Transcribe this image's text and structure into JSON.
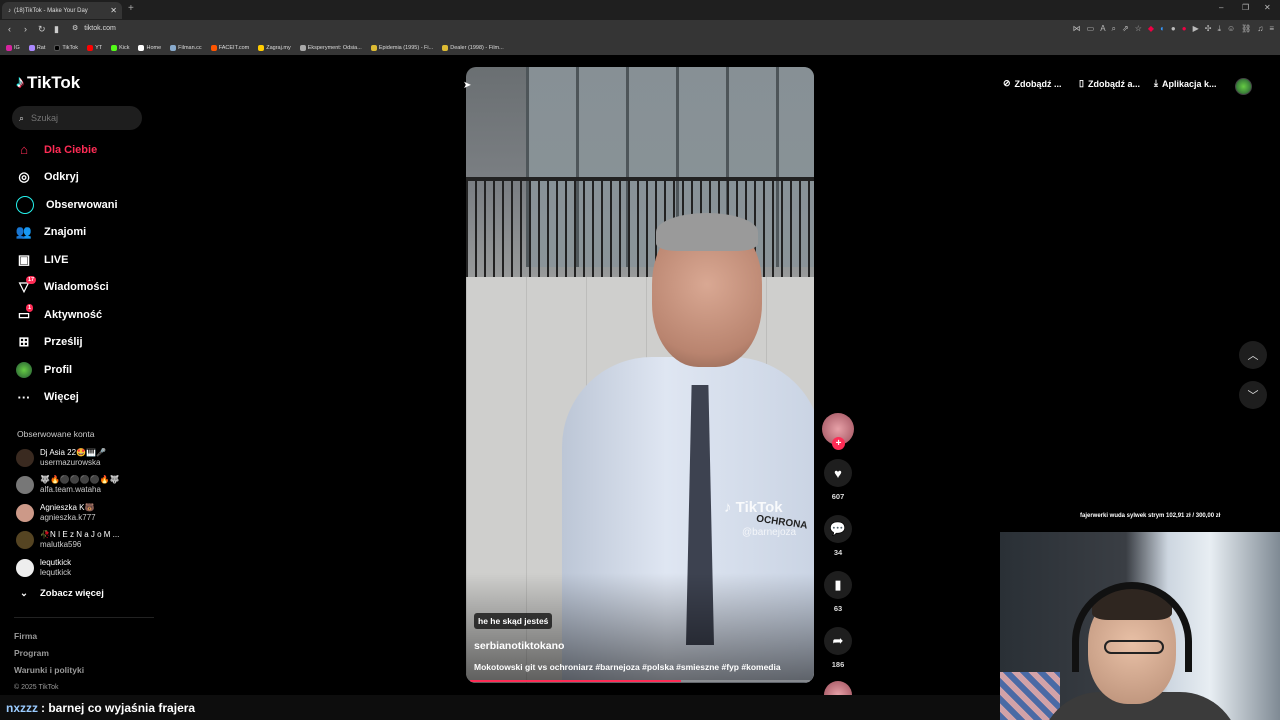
{
  "browser": {
    "tab_title": "(18)TikTok - Make Your Day",
    "url": "tiktok.com",
    "bookmarks": [
      "IG",
      "Rat",
      "TikTok",
      "YT",
      "Kick",
      "Home",
      "Filman.cc",
      "FACEIT.com",
      "Zagraj.my",
      "Eksperyment: Odsia...",
      "Epidemia (1995) - Fi...",
      "Dealer (1998) - Film..."
    ]
  },
  "app": {
    "logo": "TikTok",
    "search_placeholder": "Szukaj",
    "nav": [
      {
        "label": "Dla Ciebie",
        "icon": "home-icon"
      },
      {
        "label": "Odkryj",
        "icon": "compass-icon"
      },
      {
        "label": "Obserwowani",
        "icon": "following-icon"
      },
      {
        "label": "Znajomi",
        "icon": "friends-icon"
      },
      {
        "label": "LIVE",
        "icon": "live-icon"
      },
      {
        "label": "Wiadomości",
        "icon": "messages-icon",
        "badge": "17"
      },
      {
        "label": "Aktywność",
        "icon": "activity-icon",
        "badge": "1"
      },
      {
        "label": "Prześlij",
        "icon": "upload-icon"
      },
      {
        "label": "Profil",
        "icon": "profile-icon"
      },
      {
        "label": "Więcej",
        "icon": "more-icon"
      }
    ],
    "followed_heading": "Obserwowane konta",
    "followed": [
      {
        "name": "Dj Asia 22🤩🎹🎤",
        "user": "usermazurowska"
      },
      {
        "name": "🐺🔥⚫⚫⚫⚫🔥🐺",
        "user": "alfa.team.wataha"
      },
      {
        "name": "Agnieszka K🐻",
        "user": "agnieszka.k777"
      },
      {
        "name": "🥀N I E z N a J o M ...",
        "user": "malutka596"
      },
      {
        "name": "lequtkick",
        "user": "lequtkick"
      }
    ],
    "see_more": "Zobacz więcej",
    "footer": [
      "Firma",
      "Program",
      "Warunki i polityki"
    ],
    "copyright": "© 2025 TikTok",
    "topbar": [
      "Zdobądź ...",
      "Zdobądź a...",
      "Aplikacja k..."
    ]
  },
  "video": {
    "tag": "he he skąd jesteś",
    "author": "serbianotiktokano",
    "description": "Mokotowski git vs ochroniarz #barnejoza #polska #smieszne #fyp #komedia",
    "watermark": "TikTok",
    "watermark_user": "@barnejoza",
    "shirt_text": "OCHRONA",
    "progress_fraction": 0.62,
    "likes": "607",
    "comments": "34",
    "saves": "63",
    "shares": "186"
  },
  "stream": {
    "donation": "fajerwerki wuda sylwek strym 102,91 zł / 300,00 zł",
    "chat_user": "nxzzz",
    "chat_message": ": barnej co wyjaśnia frajera"
  },
  "colors": {
    "accent": "#fe2c55",
    "cyan": "#25f4ee"
  }
}
